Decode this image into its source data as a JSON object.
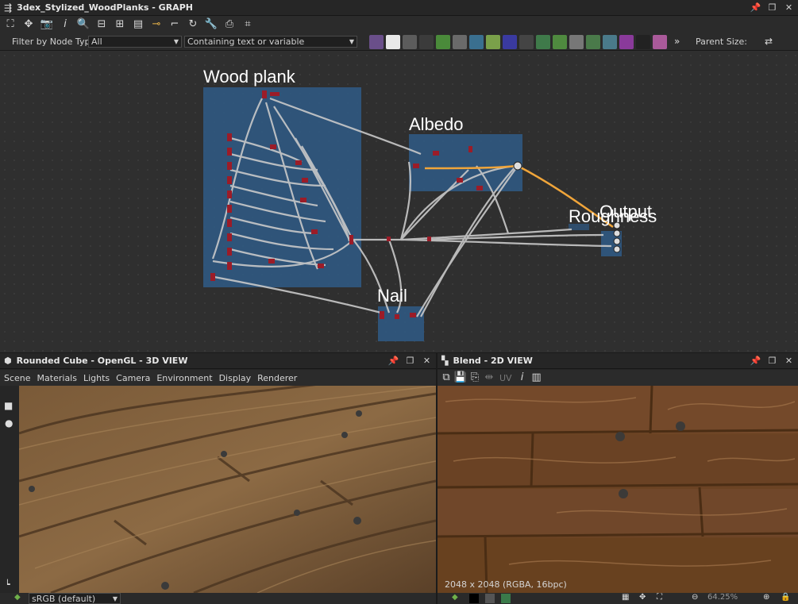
{
  "graph": {
    "title": "3dex_Stylized_WoodPlanks - GRAPH",
    "filter_label": "Filter by Node Type",
    "filter_value": "All",
    "search_placeholder": "Containing text or variable",
    "parent_size_label": "Parent Size:",
    "more_label": "»",
    "frames": [
      {
        "label": "Wood plank"
      },
      {
        "label": "Albedo"
      },
      {
        "label": "Nail"
      },
      {
        "label": "Roughness"
      },
      {
        "label": "Output"
      }
    ]
  },
  "view3d": {
    "title": "Rounded Cube - OpenGL - 3D VIEW",
    "menu": [
      "Scene",
      "Materials",
      "Lights",
      "Camera",
      "Environment",
      "Display",
      "Renderer"
    ],
    "colorspace": "sRGB (default)"
  },
  "view2d": {
    "title": "Blend - 2D VIEW",
    "uv_label": "UV",
    "resolution": "2048 x 2048 (RGBA, 16bpc)",
    "zoom": "64.25%"
  },
  "colors": {
    "frame_fill": "#2f5a86",
    "connection": "#c9c9c9",
    "selected_connection": "#f0a53a",
    "node_pin": "#9b1c28"
  }
}
